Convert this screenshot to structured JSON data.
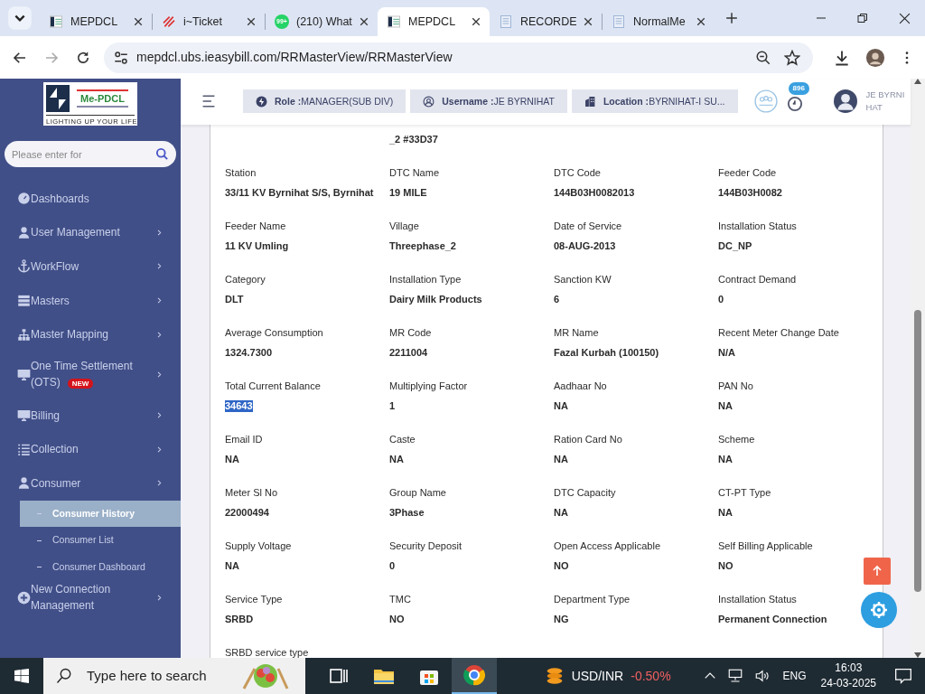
{
  "browser": {
    "tabs": [
      {
        "title": "MEPDCL",
        "kind": "logo",
        "selected": false
      },
      {
        "title": "i~Ticket",
        "kind": "ticket",
        "selected": false
      },
      {
        "title": "(210) What",
        "kind": "chat",
        "badge": "99+",
        "selected": false
      },
      {
        "title": "MEPDCL",
        "kind": "logo",
        "selected": true
      },
      {
        "title": "RECORDE",
        "kind": "doc",
        "selected": false
      },
      {
        "title": "NormalMe",
        "kind": "doc",
        "selected": false
      }
    ],
    "url": "mepdcl.ubs.ieasybill.com/RRMasterView/RRMasterView"
  },
  "sidebar": {
    "logo": {
      "name": "Me-PDCL",
      "tagline": "LIGHTING UP YOUR LIFE"
    },
    "search": {
      "placeholder": "Please enter for"
    },
    "items": [
      {
        "label": "Dashboards",
        "kind": "gauge",
        "expandable": false,
        "selected": false
      },
      {
        "label": "User Management",
        "kind": "user",
        "expandable": true,
        "selected": false
      },
      {
        "label": "WorkFlow",
        "kind": "anchor",
        "expandable": true,
        "selected": false
      },
      {
        "label": "Masters",
        "kind": "server",
        "expandable": true,
        "selected": false
      },
      {
        "label": "Master Mapping",
        "kind": "sitemap",
        "expandable": true,
        "selected": false
      },
      {
        "label": "One Time Settlement (OTS)",
        "kind": "monitor",
        "badge": "NEW",
        "expandable": true,
        "selected": false
      },
      {
        "label": "Billing",
        "kind": "monitor",
        "expandable": true,
        "selected": false
      },
      {
        "label": "Collection",
        "kind": "list",
        "expandable": true,
        "selected": false
      },
      {
        "label": "Consumer",
        "kind": "user",
        "expandable": true,
        "selected": false,
        "children": [
          {
            "label": "Consumer History",
            "selected": true
          },
          {
            "label": "Consumer List",
            "selected": false
          },
          {
            "label": "Consumer Dashboard",
            "selected": false
          }
        ]
      },
      {
        "label": "New Connection Management",
        "kind": "plus",
        "expandable": true,
        "selected": false
      }
    ]
  },
  "header": {
    "chips": [
      {
        "kind": "role",
        "text": "**Role :**MANAGER(SUB DIV)"
      },
      {
        "kind": "user",
        "text": "**Username :**JE BYRNIHAT"
      },
      {
        "kind": "location",
        "text": "**Location :**BYRNIHAT-I SU..."
      }
    ],
    "notification_count": "896",
    "user_name_lines": [
      "JE BYRNI",
      "HAT"
    ]
  },
  "partial_row_value": "_2 #33D37",
  "fields": [
    {
      "label": "Station",
      "value": "33/11 KV Byrnihat S/S, Byrnihat",
      "selected": false
    },
    {
      "label": "DTC Name",
      "value": "19 MILE",
      "selected": false
    },
    {
      "label": "DTC Code",
      "value": "144B03H0082013",
      "selected": false
    },
    {
      "label": "Feeder Code",
      "value": "144B03H0082",
      "selected": false
    },
    {
      "label": "Feeder Name",
      "value": "11 KV Umling",
      "selected": false
    },
    {
      "label": "Village",
      "value": "Threephase_2",
      "selected": false
    },
    {
      "label": "Date of Service",
      "value": "08-AUG-2013",
      "selected": false
    },
    {
      "label": "Installation Status",
      "value": "DC_NP",
      "selected": false
    },
    {
      "label": "Category",
      "value": "DLT",
      "selected": false
    },
    {
      "label": "Installation Type",
      "value": "Dairy Milk Products",
      "selected": false
    },
    {
      "label": "Sanction KW",
      "value": "6",
      "selected": false
    },
    {
      "label": "Contract Demand",
      "value": "0",
      "selected": false
    },
    {
      "label": "Average Consumption",
      "value": "1324.7300",
      "selected": false
    },
    {
      "label": "MR Code",
      "value": "2211004",
      "selected": false
    },
    {
      "label": "MR Name",
      "value": "Fazal Kurbah (100150)",
      "selected": false
    },
    {
      "label": "Recent Meter Change Date",
      "value": "N/A",
      "selected": false
    },
    {
      "label": "Total Current Balance",
      "value": "34643",
      "selected": true
    },
    {
      "label": "Multiplying Factor",
      "value": "1",
      "selected": false
    },
    {
      "label": "Aadhaar No",
      "value": "NA",
      "selected": false
    },
    {
      "label": "PAN No",
      "value": "NA",
      "selected": false
    },
    {
      "label": "Email ID",
      "value": "NA",
      "selected": false
    },
    {
      "label": "Caste",
      "value": "NA",
      "selected": false
    },
    {
      "label": "Ration Card No",
      "value": "NA",
      "selected": false
    },
    {
      "label": "Scheme",
      "value": "NA",
      "selected": false
    },
    {
      "label": "Meter Sl No",
      "value": "22000494",
      "selected": false
    },
    {
      "label": "Group Name",
      "value": "3Phase",
      "selected": false
    },
    {
      "label": "DTC Capacity",
      "value": "NA",
      "selected": false
    },
    {
      "label": "CT-PT Type",
      "value": "NA",
      "selected": false
    },
    {
      "label": "Supply Voltage",
      "value": "NA",
      "selected": false
    },
    {
      "label": "Security Deposit",
      "value": "0",
      "selected": false
    },
    {
      "label": "Open Access Applicable",
      "value": "NO",
      "selected": false
    },
    {
      "label": "Self Billing Applicable",
      "value": "NO",
      "selected": false
    },
    {
      "label": "Service Type",
      "value": "SRBD",
      "selected": false
    },
    {
      "label": "TMC",
      "value": "NO",
      "selected": false
    },
    {
      "label": "Department Type",
      "value": "NG",
      "selected": false
    },
    {
      "label": "Installation Status",
      "value": "Permanent Connection",
      "selected": false
    },
    {
      "label": "SRBD service type",
      "selected": false
    }
  ],
  "taskbar": {
    "search_placeholder": "Type here to search",
    "apps": [
      {
        "kind": "taskview",
        "selected": false
      },
      {
        "kind": "folder",
        "selected": false
      },
      {
        "kind": "store",
        "selected": false
      },
      {
        "kind": "chrome",
        "selected": true
      }
    ],
    "ticker": {
      "label": "USD/INR",
      "change": "-0.50%"
    },
    "language": "ENG",
    "time": "16:03",
    "date": "24-03-2025"
  }
}
